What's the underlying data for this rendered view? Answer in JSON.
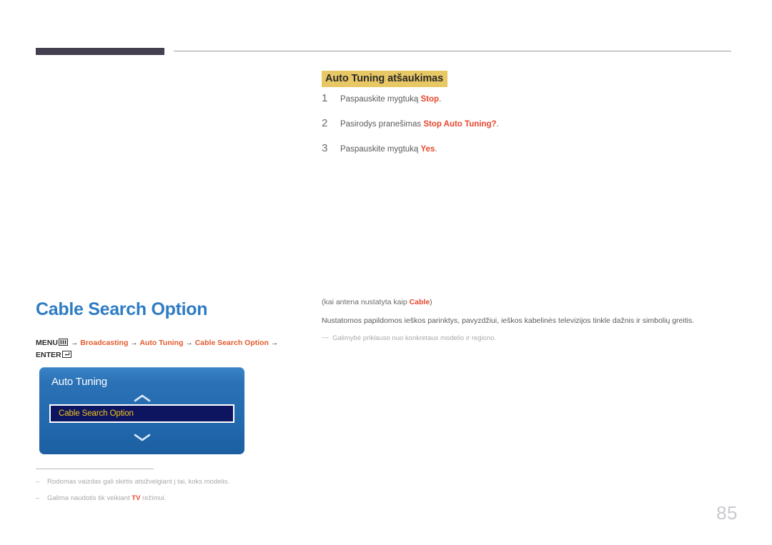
{
  "header": {
    "bar_color": "#454050",
    "rule_color": "#9a9aa2"
  },
  "right_top": {
    "badge": "Auto Tuning atšaukimas",
    "badge_bg": "#e8c864",
    "steps": [
      {
        "number": "1",
        "prefix": "Paspauskite mygtuką ",
        "accent": "Stop",
        "suffix": "."
      },
      {
        "number": "2",
        "prefix": "Pasirodys pranešimas ",
        "accent": "Stop Auto Tuning?",
        "suffix": "."
      },
      {
        "number": "3",
        "prefix": "Paspauskite mygtuką ",
        "accent": "Yes",
        "suffix": "."
      }
    ]
  },
  "left": {
    "heading": "Cable Search Option",
    "heading_color": "#2e7cc4",
    "menu_path": {
      "menu_label": "MENU",
      "menu_icon": "menu-grid-icon",
      "arrow": "→",
      "item1": "Broadcasting",
      "item2": "Auto Tuning",
      "item3": "Cable Search Option",
      "enter_label": "ENTER",
      "enter_icon": "enter-return-icon",
      "accent_color": "#e05a2b"
    },
    "osd": {
      "title": "Auto Tuning",
      "up_icon": "chevron-up-icon",
      "down_icon": "chevron-down-icon",
      "selected_item": "Cable Search Option",
      "bg_color": "#2a6fb8",
      "item_bg_color": "#0d1560",
      "item_text_color": "#f5c518"
    },
    "footnotes": [
      {
        "dash": "‒",
        "text": "Rodomas vaizdas gali skirtis atsižvelgiant į tai, koks modelis."
      },
      {
        "dash": "‒",
        "prefix": "Galima naudotis tik veikiant ",
        "accent": "TV",
        "suffix": " režimui."
      }
    ]
  },
  "right_body": {
    "condition_prefix": "(kai antena nustatyta kaip ",
    "condition_accent": "Cable",
    "condition_suffix": ")",
    "description": "Nustatomos papildomos ieškos parinktys, pavyzdžiui, ieškos kabelinės televizijos tinkle dažnis ir simbolių greitis.",
    "note_dash": "—",
    "note": "Galimybė priklauso nuo konkretaus modelio ir regiono."
  },
  "footer": {
    "page_number": "85"
  }
}
